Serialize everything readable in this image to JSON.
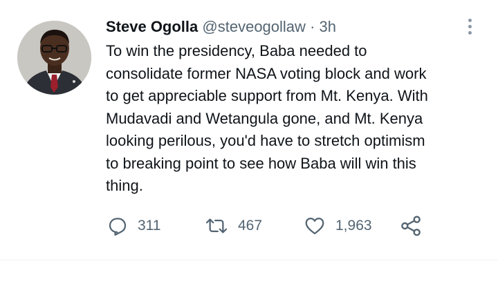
{
  "tweet": {
    "author_name": "Steve Ogolla",
    "author_handle": "@steveogollaw",
    "separator": "·",
    "timestamp": "3h",
    "text_lines": [
      "To win the presidency, Baba needed to",
      "consolidate former NASA voting block and work",
      "to get appreciable support from Mt. Kenya. With",
      "Mudavadi and Wetangula gone, and Mt. Kenya",
      "looking perilous, you'd have to stretch optimism",
      "to breaking point to see how Baba will win this",
      "thing."
    ]
  },
  "actions": {
    "reply": {
      "icon": "reply-icon",
      "count": "311"
    },
    "retweet": {
      "icon": "retweet-icon",
      "count": "467"
    },
    "like": {
      "icon": "heart-icon",
      "count": "1,963"
    },
    "share": {
      "icon": "share-icon"
    }
  },
  "colors": {
    "text_primary": "#0f1419",
    "text_secondary": "#536471",
    "icon": "#536471",
    "divider": "#eff3f4"
  }
}
